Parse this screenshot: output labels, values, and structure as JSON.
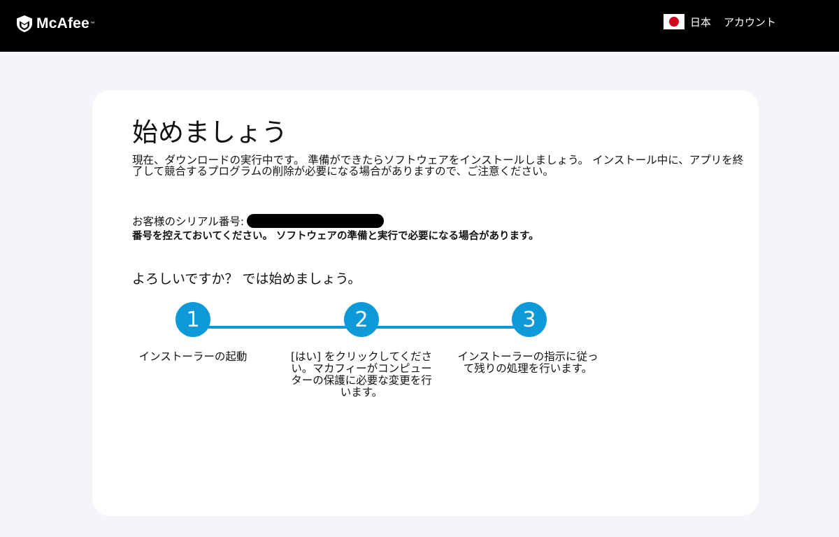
{
  "header": {
    "brand": "McAfee",
    "country": "日本",
    "account": "アカウント"
  },
  "main": {
    "title": "始めましょう",
    "intro": "現在、ダウンロードの実行中です。 準備ができたらソフトウェアをインストールしましょう。 インストール中に、アプリを終了して競合するプログラムの削除が必要になる場合がありますので、ご注意ください。",
    "serial_label": "お客様のシリアル番号:",
    "serial_note": "番号を控えておいてください。 ソフトウェアの準備と実行で必要になる場合があります。",
    "ready_text": "よろしいですか？ では始めましょう。",
    "steps": [
      {
        "number": "1",
        "label": "インストーラーの起動"
      },
      {
        "number": "2",
        "label": "[はい] をクリックしてください。マカフィーがコンピューターの保護に必要な変更を行います。"
      },
      {
        "number": "3",
        "label": "インストーラーの指示に従って残りの処理を行います。"
      }
    ]
  },
  "colors": {
    "header_bg": "#000000",
    "page_bg": "#f3f5f9",
    "accent": "#0e9ad8",
    "flag_red": "#d0021b"
  },
  "icons": [
    "mcafee-shield-icon",
    "japan-flag-icon"
  ]
}
